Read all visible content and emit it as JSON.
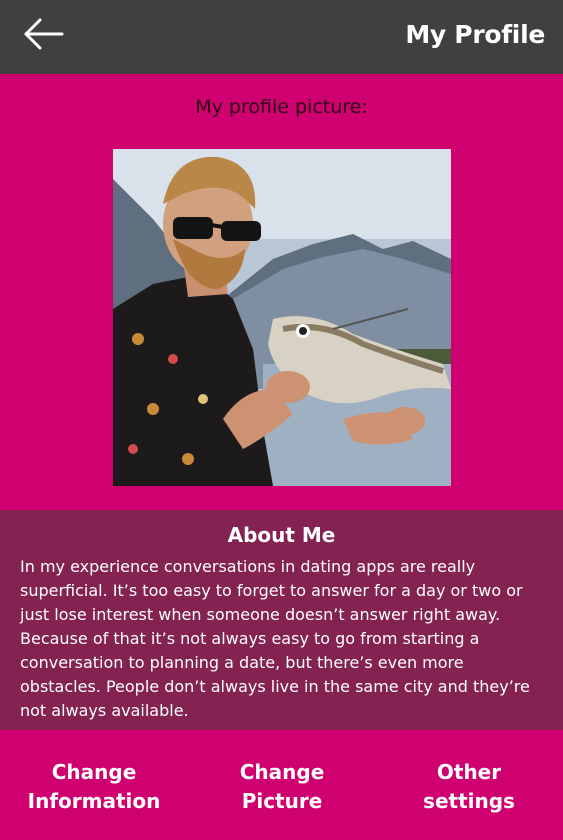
{
  "header": {
    "title": "My Profile",
    "back_icon": "arrow-left-icon"
  },
  "profile": {
    "picture_label": "My profile picture:"
  },
  "about": {
    "title": "About Me",
    "text": "In my experience conversations in dating apps are really superficial. It’s too easy to forget to answer for a day or two or just lose interest when someone doesn’t answer right away. Because of that it’s not always easy to go from starting a conversation to planning a date, but there’s even more obstacles. People don’t always live in the same city and they’re not always available."
  },
  "actions": {
    "change_information": [
      "Change",
      "Information"
    ],
    "change_picture": [
      "Change",
      "Picture"
    ],
    "other_settings": [
      "Other",
      "settings"
    ]
  },
  "colors": {
    "header_bg": "#404040",
    "primary": "#cf006f",
    "about_bg": "#842252",
    "text_light": "#ffffff"
  }
}
